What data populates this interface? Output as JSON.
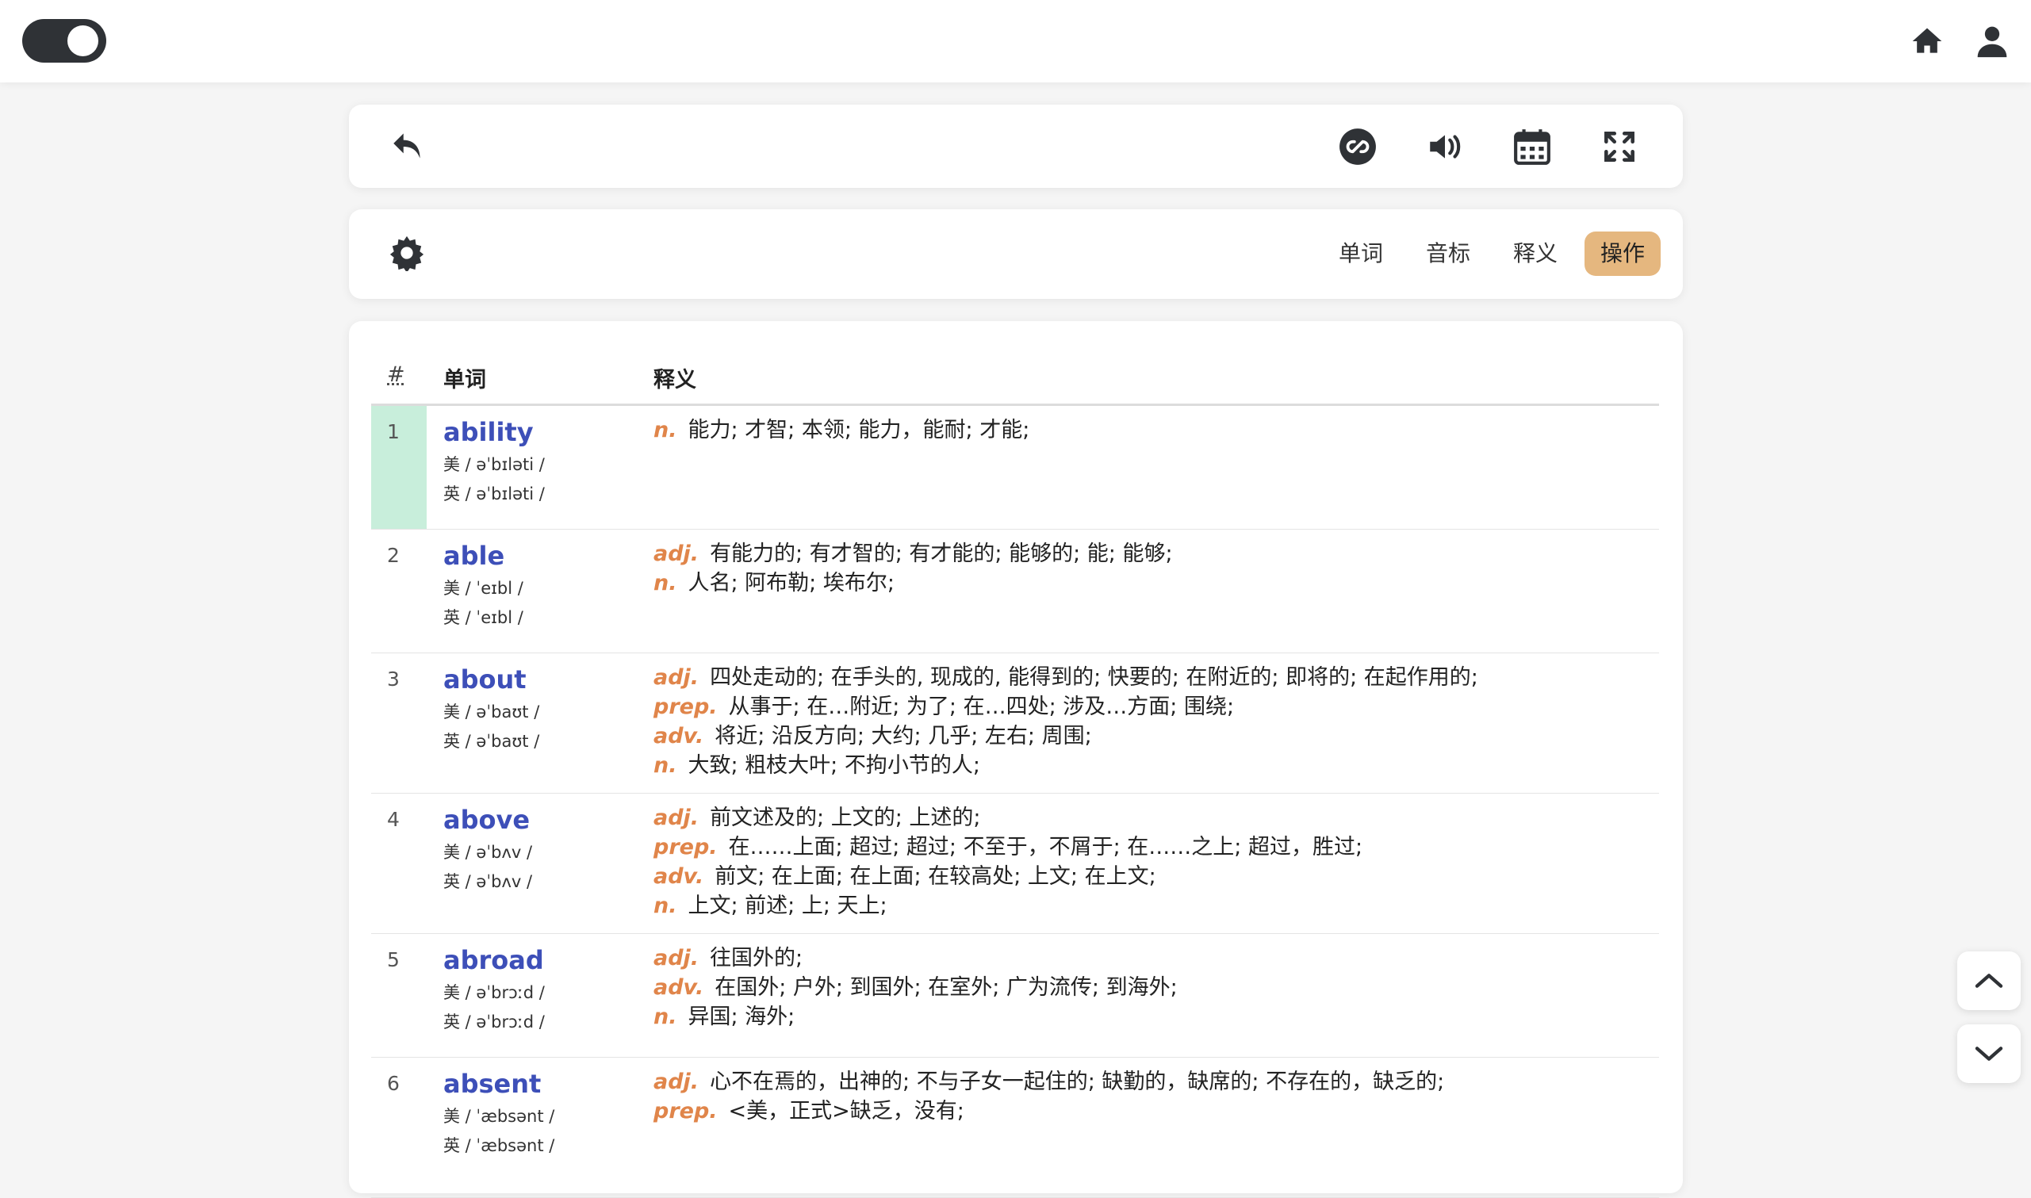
{
  "header": {
    "toggle_state": "on",
    "icons": [
      "home-icon",
      "user-icon"
    ]
  },
  "toolbar": {
    "icons": [
      "undo-icon",
      "link-icon",
      "volume-icon",
      "calendar-icon",
      "fullscreen-icon"
    ]
  },
  "filter": {
    "settings_icon": "gear-icon",
    "tabs": [
      {
        "label": "单词",
        "active": false
      },
      {
        "label": "音标",
        "active": false
      },
      {
        "label": "释义",
        "active": false
      },
      {
        "label": "操作",
        "active": true
      }
    ]
  },
  "table": {
    "headers": {
      "num": "#",
      "word": "单词",
      "definition": "释义"
    },
    "rows": [
      {
        "num": "1",
        "word": "ability",
        "us": "美 / əˈbɪləti /",
        "uk": "英 / əˈbɪləti /",
        "selected": true,
        "defs": [
          {
            "pos": "n.",
            "text": "能力; 才智; 本领; 能力，能耐; 才能;"
          }
        ]
      },
      {
        "num": "2",
        "word": "able",
        "us": "美 / ˈeɪbl /",
        "uk": "英 / ˈeɪbl /",
        "defs": [
          {
            "pos": "adj.",
            "text": "有能力的; 有才智的; 有才能的; 能够的; 能; 能够;"
          },
          {
            "pos": "n.",
            "text": "人名; 阿布勒; 埃布尔;"
          }
        ]
      },
      {
        "num": "3",
        "word": "about",
        "us": "美 / əˈbaʊt /",
        "uk": "英 / əˈbaʊt /",
        "defs": [
          {
            "pos": "adj.",
            "text": "四处走动的; 在手头的, 现成的, 能得到的; 快要的; 在附近的; 即将的; 在起作用的;"
          },
          {
            "pos": "prep.",
            "text": "从事于; 在…附近; 为了; 在…四处; 涉及…方面; 围绕;"
          },
          {
            "pos": "adv.",
            "text": "将近; 沿反方向; 大约; 几乎; 左右; 周围;"
          },
          {
            "pos": "n.",
            "text": "大致; 粗枝大叶; 不拘小节的人;"
          }
        ]
      },
      {
        "num": "4",
        "word": "above",
        "us": "美 / əˈbʌv /",
        "uk": "英 / əˈbʌv /",
        "defs": [
          {
            "pos": "adj.",
            "text": "前文述及的; 上文的; 上述的;"
          },
          {
            "pos": "prep.",
            "text": "在……上面; 超过; 超过; 不至于，不屑于; 在……之上; 超过，胜过;"
          },
          {
            "pos": "adv.",
            "text": "前文; 在上面; 在上面; 在较高处; 上文; 在上文;"
          },
          {
            "pos": "n.",
            "text": "上文; 前述; 上; 天上;"
          }
        ]
      },
      {
        "num": "5",
        "word": "abroad",
        "us": "美 / əˈbrɔːd /",
        "uk": "英 / əˈbrɔːd /",
        "defs": [
          {
            "pos": "adj.",
            "text": "往国外的;"
          },
          {
            "pos": "adv.",
            "text": "在国外; 户外; 到国外; 在室外; 广为流传; 到海外;"
          },
          {
            "pos": "n.",
            "text": "异国; 海外;"
          }
        ]
      },
      {
        "num": "6",
        "word": "absent",
        "us": "美 / ˈæbsənt /",
        "uk": "英 / ˈæbsənt /",
        "defs": [
          {
            "pos": "adj.",
            "text": "心不在焉的，出神的; 不与子女一起住的; 缺勤的，缺席的; 不存在的，缺乏的;"
          },
          {
            "pos": "prep.",
            "text": "<美，正式>缺乏，没有;"
          }
        ]
      }
    ]
  },
  "scroll": {
    "up_icon": "chevron-up-icon",
    "down_icon": "chevron-down-icon"
  },
  "colors": {
    "accent_tab": "#e5b77f",
    "word": "#3d4fb8",
    "pos": "#e0854a",
    "selected_row": "#c8eedb"
  }
}
